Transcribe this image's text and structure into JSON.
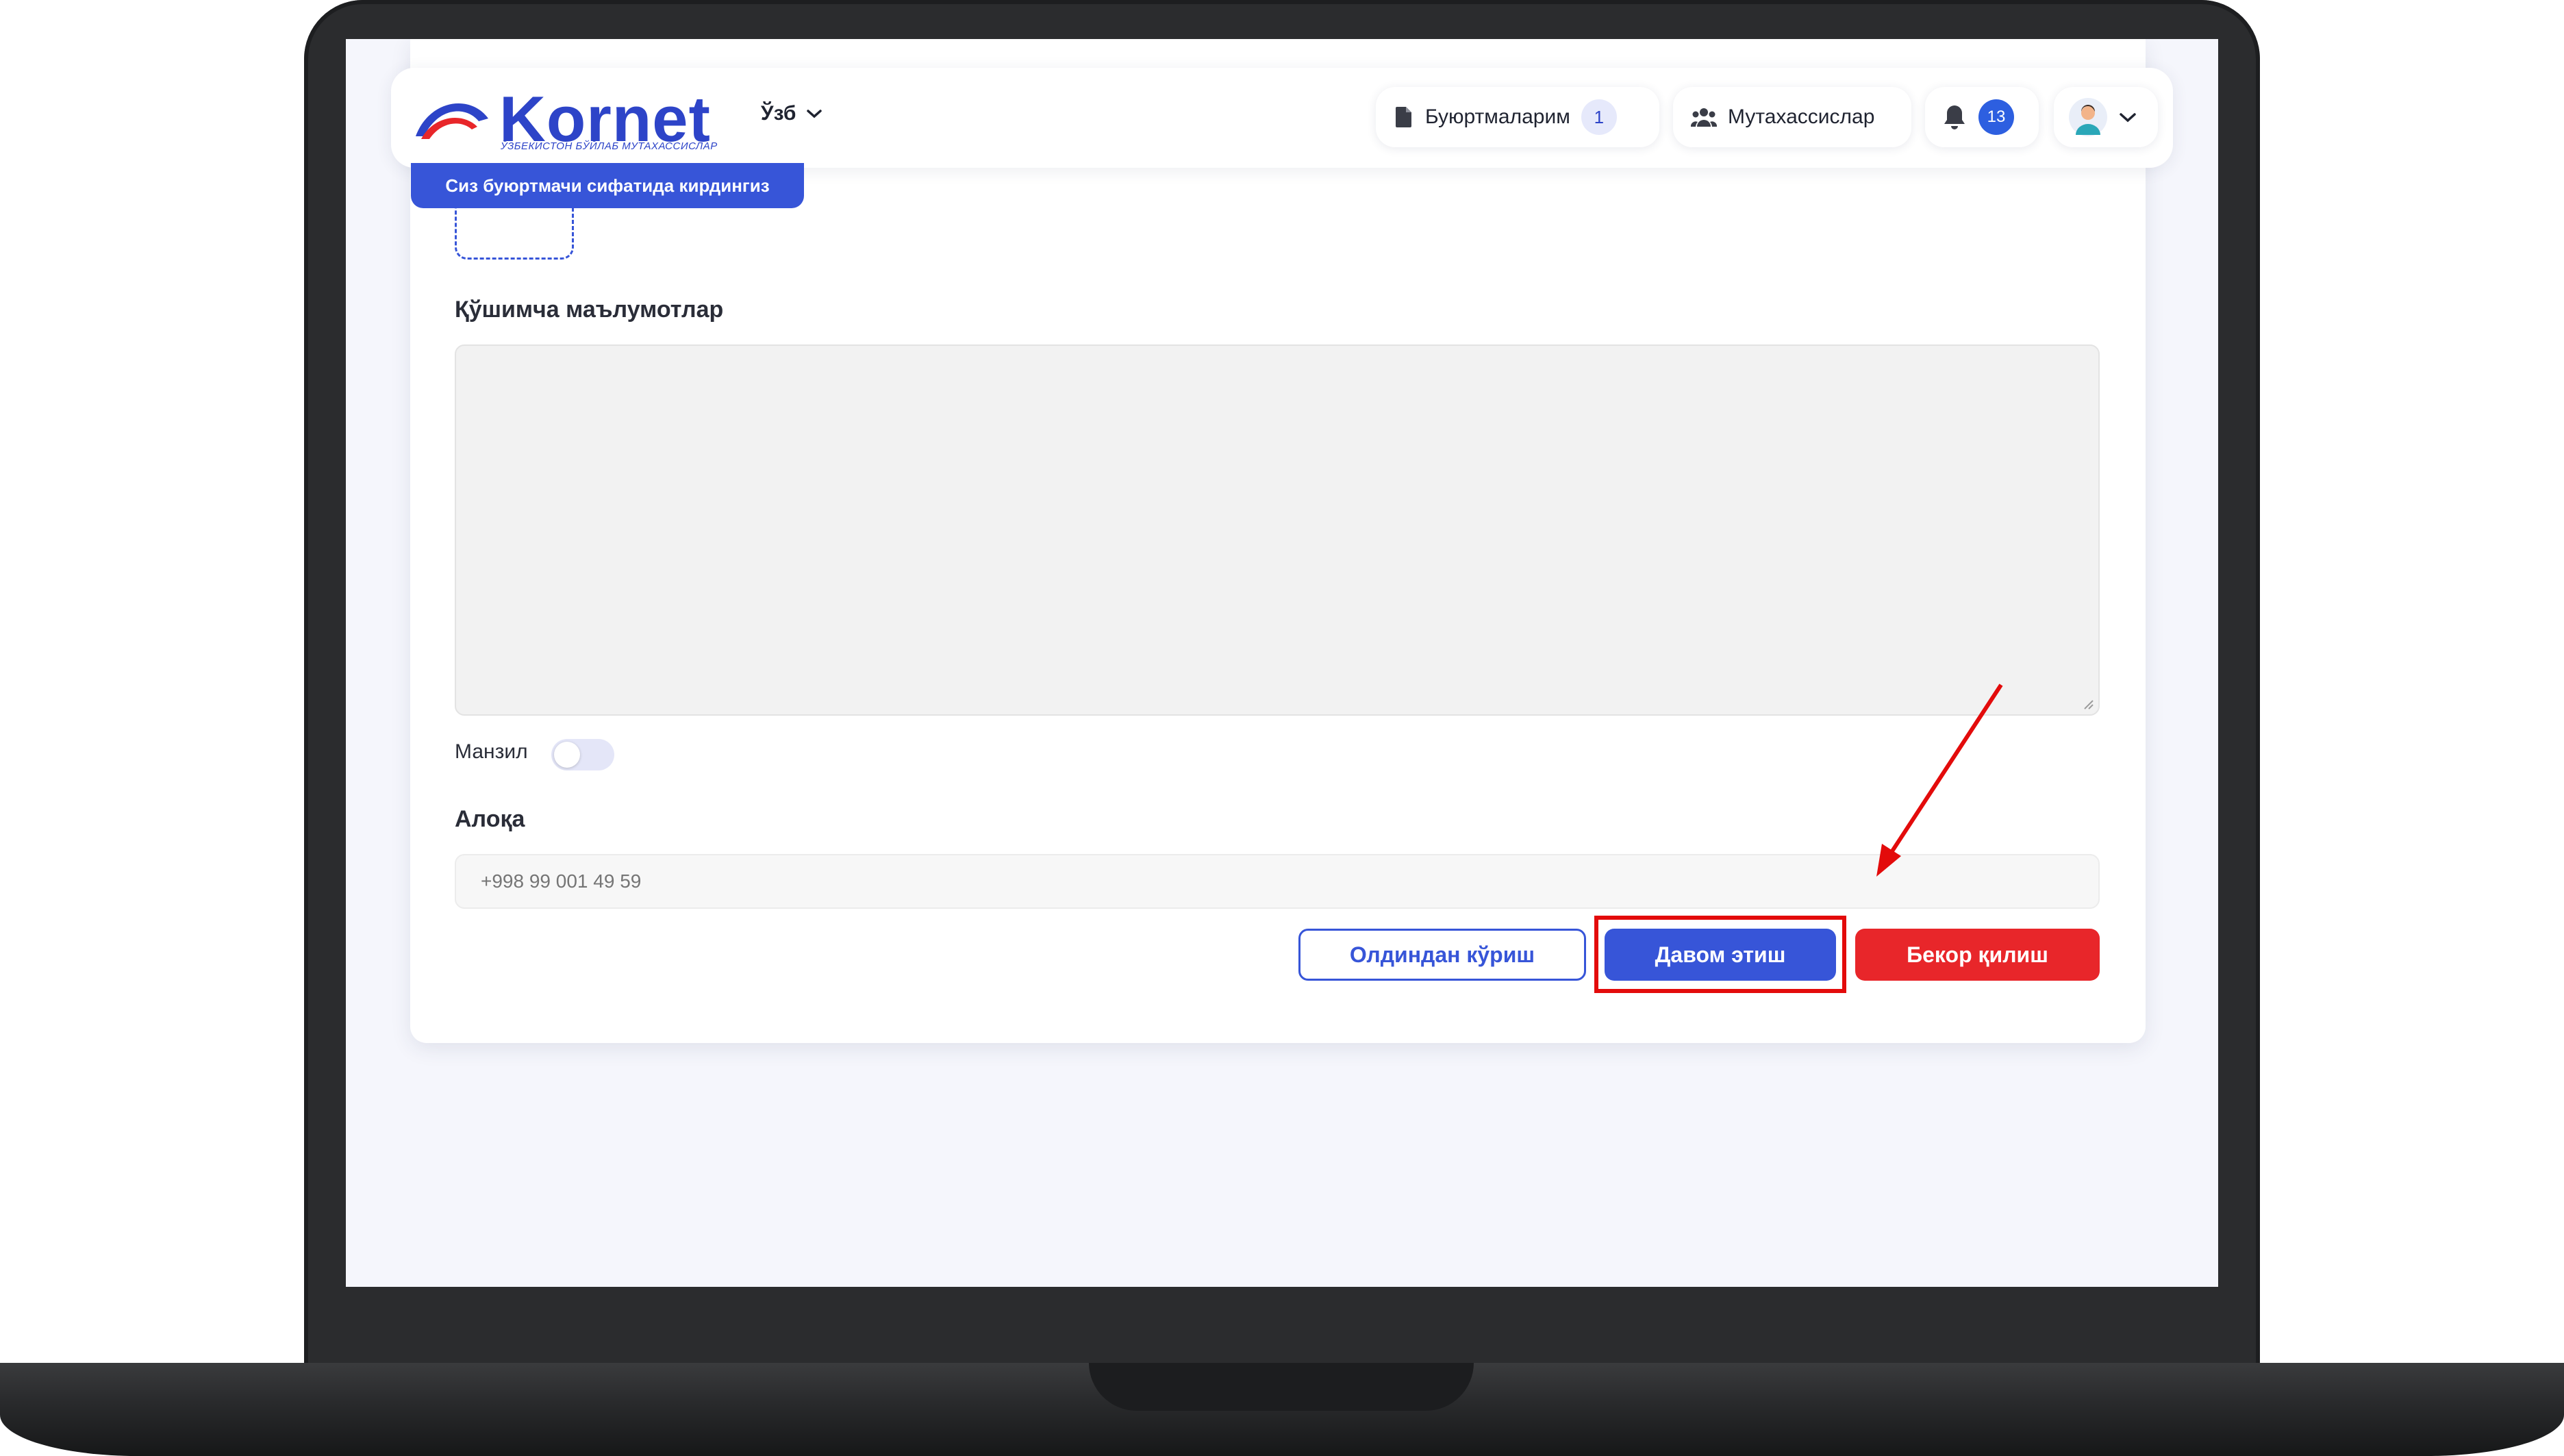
{
  "header": {
    "brand": "Kornet",
    "brand_tagline": "ЎЗБЕКИСТОН БЎЙЛАБ МУТАХАССИСЛАР",
    "language": "Ўзб",
    "orders_label": "Буюртмаларим",
    "orders_count": "1",
    "specialists_label": "Мутахассислар",
    "notifications_count": "13"
  },
  "role_banner": "Сиз буюртмачи сифатида кирдингиз",
  "form": {
    "additional_info_label": "Қўшимча маълумотлар",
    "additional_info_value": "",
    "address_label": "Манзил",
    "address_toggle_on": false,
    "contact_label": "Алоқа",
    "contact_placeholder": "+998 99 001 49 59"
  },
  "buttons": {
    "preview": "Олдиндан кўриш",
    "continue": "Давом этиш",
    "cancel": "Бекор қилиш"
  },
  "colors": {
    "primary": "#3755d8",
    "danger": "#e8262a",
    "annotation": "#e30b0b"
  }
}
